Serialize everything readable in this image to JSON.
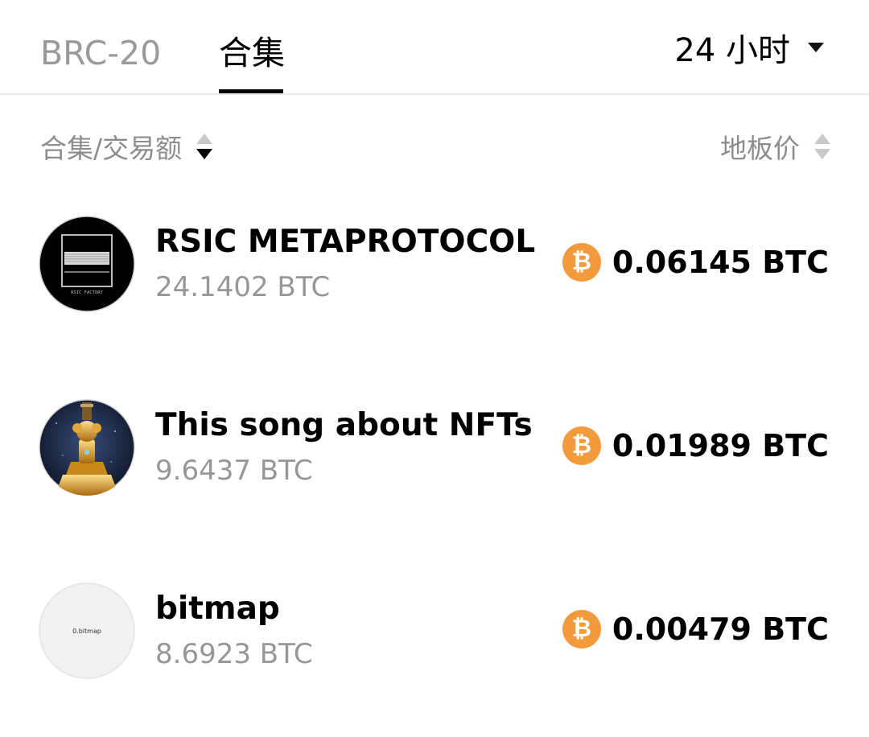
{
  "tabs": {
    "brc20_label": "BRC-20",
    "collections_label": "合集"
  },
  "period": {
    "label": "24 小时"
  },
  "columns": {
    "left_label": "合集/交易额",
    "right_label": "地板价"
  },
  "collections": [
    {
      "name": "RSIC METAPROTOCOL",
      "volume": "24.1402 BTC",
      "floor_price": "0.06145 BTC",
      "avatar_text": "RSIC FACTORY"
    },
    {
      "name": "This song about NFTs",
      "volume": "9.6437 BTC",
      "floor_price": "0.01989 BTC"
    },
    {
      "name": "bitmap",
      "volume": "8.6923 BTC",
      "floor_price": "0.00479 BTC",
      "avatar_text": "0.bitmap"
    }
  ],
  "icons": {
    "btc_symbol": "₿"
  },
  "colors": {
    "btc_orange": "#f39a3c",
    "muted_text": "#979797",
    "active_tab": "#000000"
  }
}
